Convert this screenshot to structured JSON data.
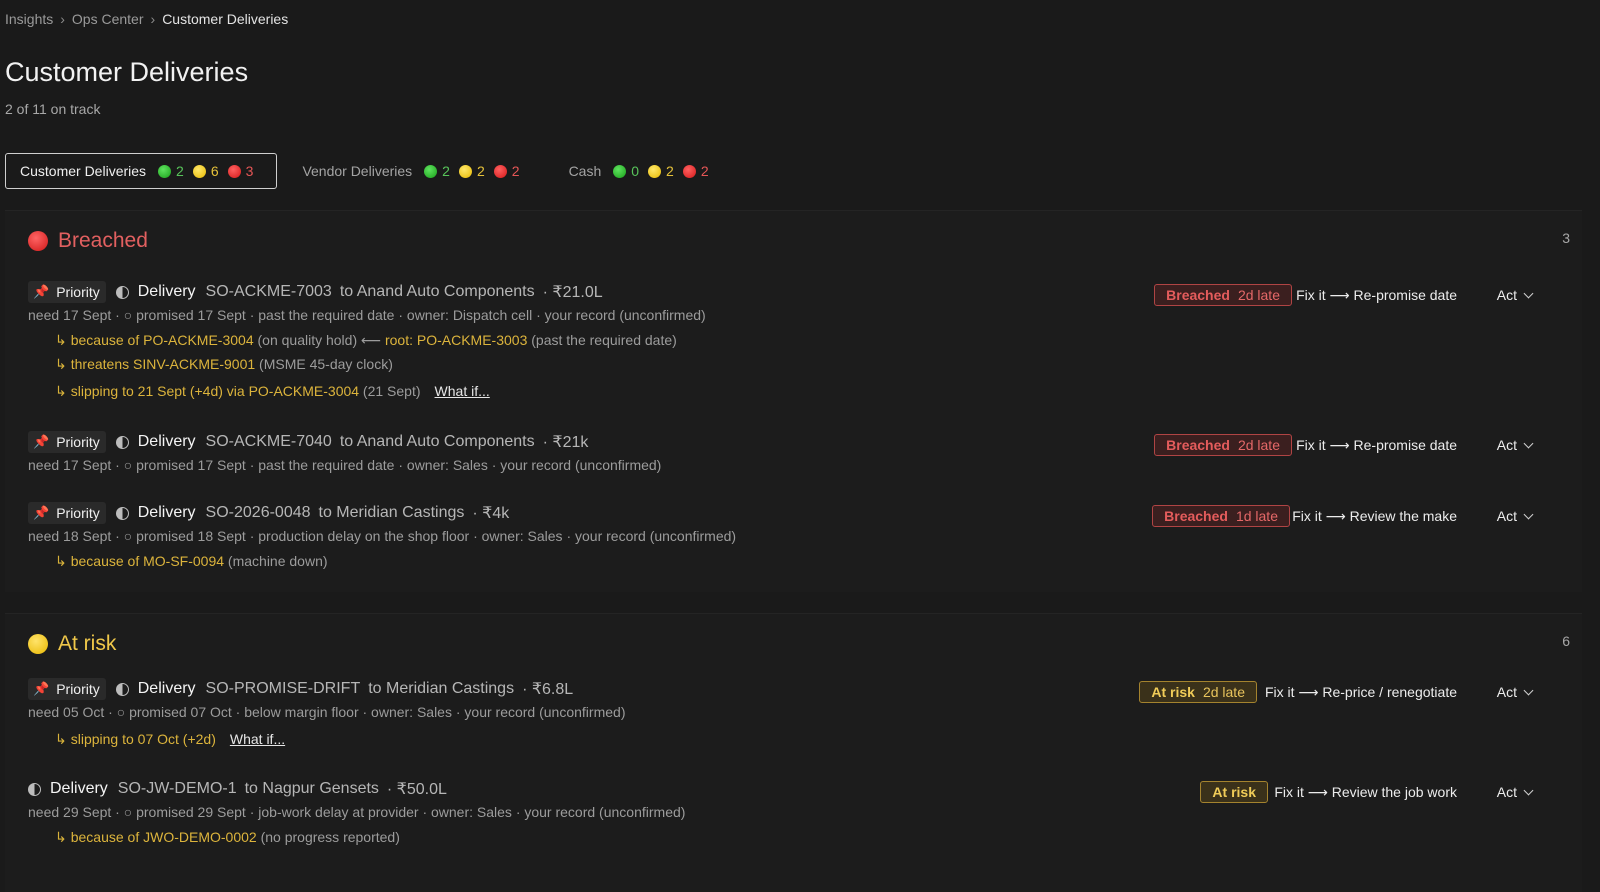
{
  "breadcrumb": [
    "Insights",
    "Ops Center",
    "Customer Deliveries"
  ],
  "page": {
    "title": "Customer Deliveries",
    "subtitle": "2 of 11 on track"
  },
  "tabs": [
    {
      "label": "Customer Deliveries",
      "green": "2",
      "yellow": "6",
      "red": "3",
      "active": true
    },
    {
      "label": "Vendor Deliveries",
      "green": "2",
      "yellow": "2",
      "red": "2",
      "active": false
    },
    {
      "label": "Cash",
      "green": "0",
      "yellow": "2",
      "red": "2",
      "active": false
    }
  ],
  "common": {
    "priority": "Priority",
    "act": "Act",
    "what_if": "What if..."
  },
  "sections": {
    "breached": {
      "title": "Breached",
      "count": "3",
      "rows": [
        {
          "kind": "Delivery",
          "id": "SO-ACKME-7003",
          "customer": "to Anand Auto Components",
          "amount": "· ₹21.0L",
          "meta": "need 17 Sept · ○ promised 17 Sept · past the required date · owner: Dispatch cell · your record (unconfirmed)",
          "reason1_link": "because of PO-ACKME-3004",
          "reason1_rest": " (on quality hold) ⟵ ",
          "reason1_link2": "root: PO-ACKME-3003",
          "reason1_rest2": " (past the required date)",
          "reason2_link": "threatens SINV-ACKME-9001",
          "reason2_rest": " (MSME 45-day clock)",
          "reason3_link": "slipping to 21 Sept (+4d) via PO-ACKME-3004",
          "reason3_rest": " (21 Sept)",
          "badge_strong": "Breached",
          "badge_rest": "2d late",
          "fix": "Fix it ⟶ Re-promise date"
        },
        {
          "kind": "Delivery",
          "id": "SO-ACKME-7040",
          "customer": "to Anand Auto Components",
          "amount": "· ₹21k",
          "meta": "need 17 Sept · ○ promised 17 Sept · past the required date · owner: Sales · your record (unconfirmed)",
          "badge_strong": "Breached",
          "badge_rest": "2d late",
          "fix": "Fix it ⟶ Re-promise date"
        },
        {
          "kind": "Delivery",
          "id": "SO-2026-0048",
          "customer": "to Meridian Castings",
          "amount": "· ₹4k",
          "meta": "need 18 Sept · ○ promised 18 Sept · production delay on the shop floor · owner: Sales · your record (unconfirmed)",
          "reason1_link": "because of MO-SF-0094",
          "reason1_rest": " (machine down)",
          "badge_strong": "Breached",
          "badge_rest": "1d late",
          "fix": "Fix it ⟶ Review the make"
        }
      ]
    },
    "at_risk": {
      "title": "At risk",
      "count": "6",
      "rows": [
        {
          "kind": "Delivery",
          "id": "SO-PROMISE-DRIFT",
          "customer": "to Meridian Castings",
          "amount": "· ₹6.8L",
          "meta": "need 05 Oct · ○ promised 07 Oct · below margin floor · owner: Sales · your record (unconfirmed)",
          "reason1_link": "slipping to 07 Oct (+2d)",
          "badge_strong": "At risk",
          "badge_rest": "2d late",
          "fix": "Fix it ⟶ Re-price / renegotiate"
        },
        {
          "kind": "Delivery",
          "id": "SO-JW-DEMO-1",
          "customer": "to Nagpur Gensets",
          "amount": "· ₹50.0L",
          "meta": "need 29 Sept · ○ promised 29 Sept · job-work delay at provider · owner: Sales · your record (unconfirmed)",
          "reason1_link": "because of JWO-DEMO-0002",
          "reason1_rest": " (no progress reported)",
          "badge_strong": "At risk",
          "fix": "Fix it ⟶ Review the job work"
        }
      ]
    }
  },
  "icons": {
    "pin": "pin-icon",
    "half": "half-circle-icon",
    "chevron": "chevron-down-icon"
  },
  "colors": {
    "breached": "#e26060",
    "at_risk": "#f0c84a",
    "link": "#dcb43c"
  }
}
